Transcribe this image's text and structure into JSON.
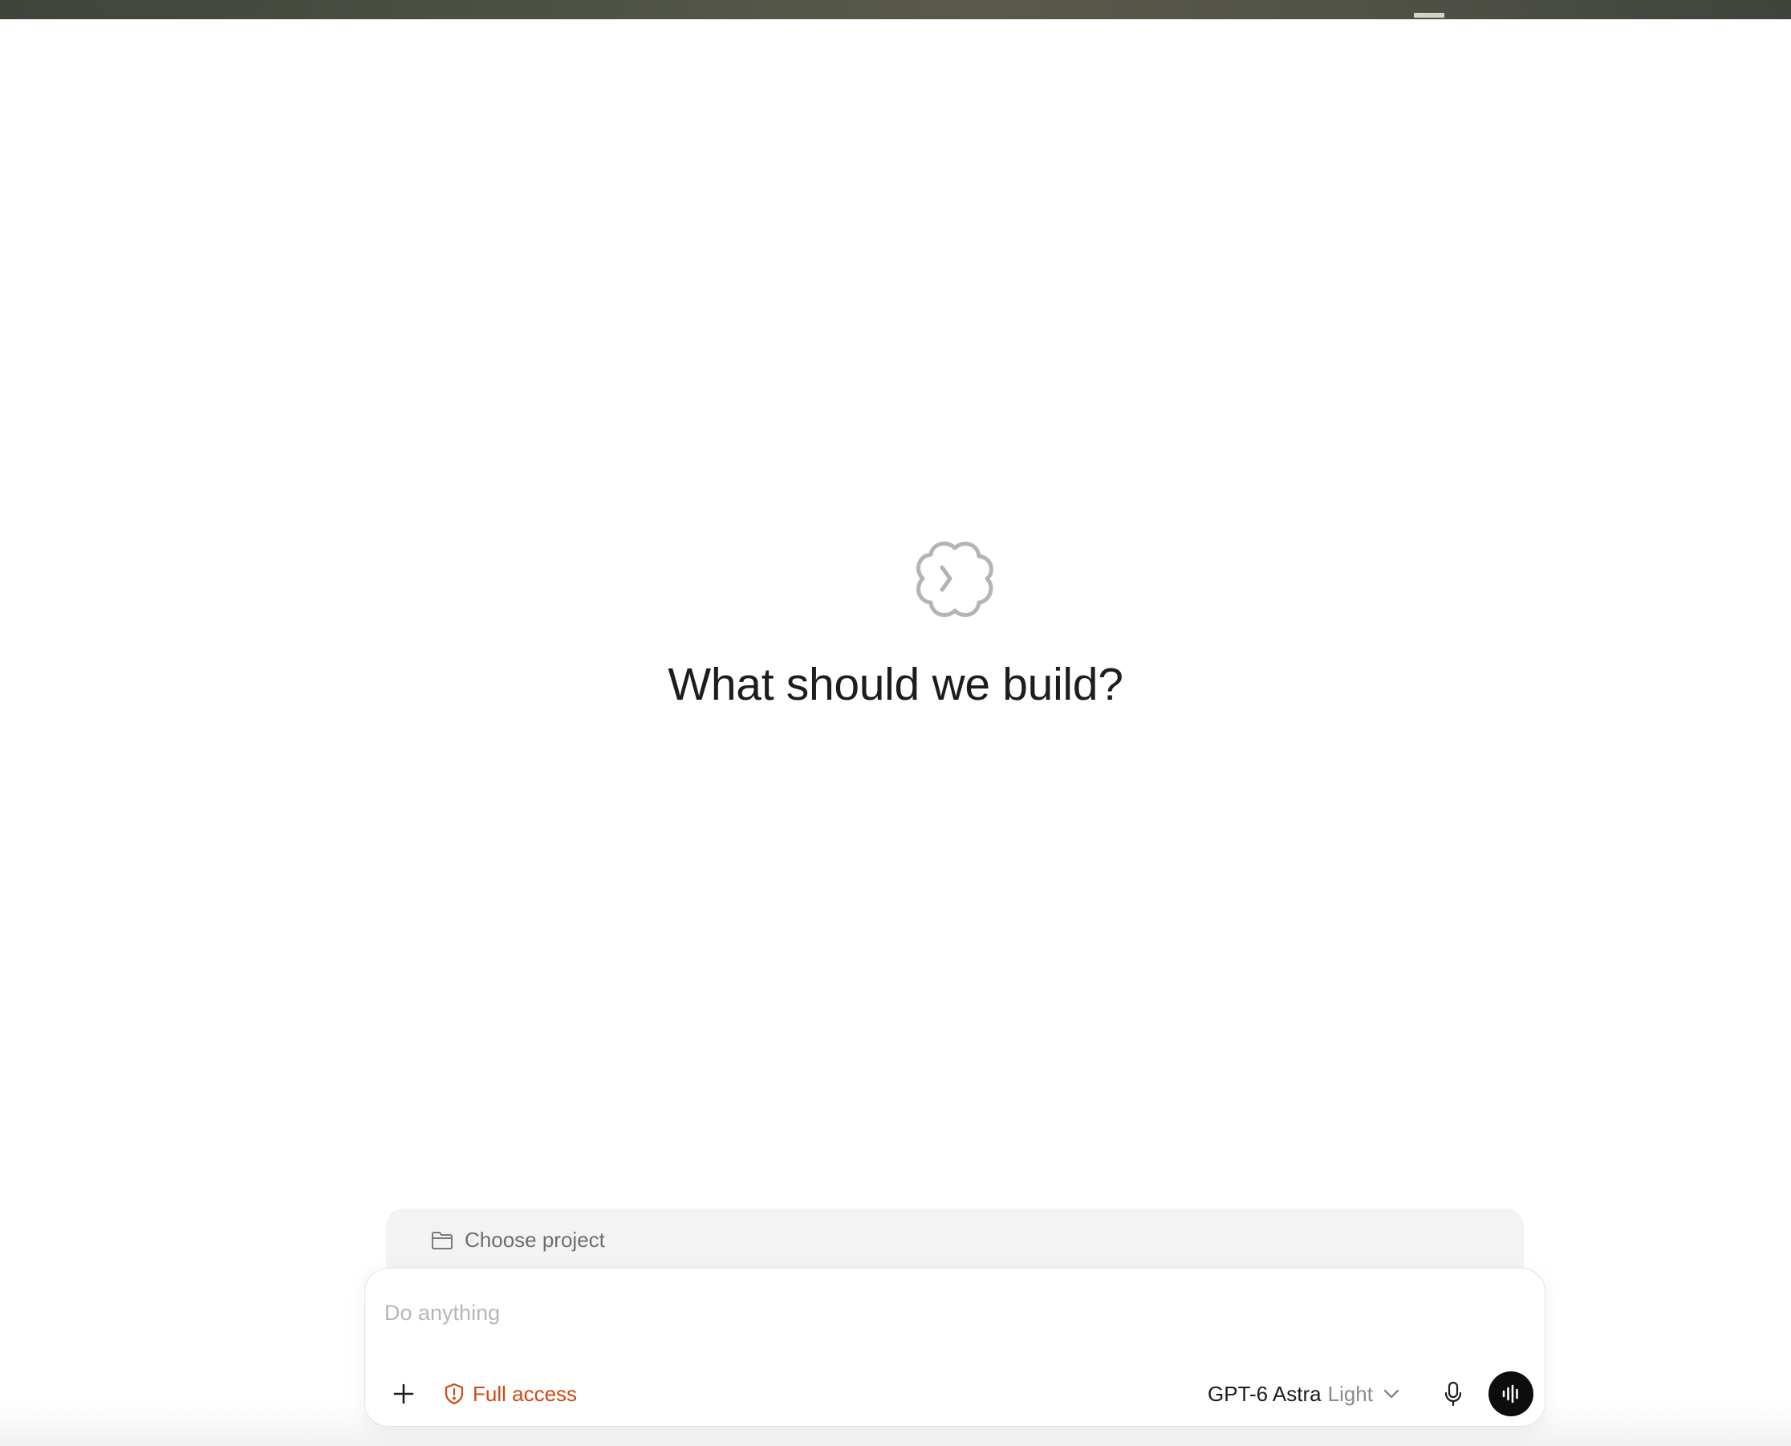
{
  "hero": {
    "title": "What should we build?",
    "logo_icon": "app-logo-icon"
  },
  "project": {
    "label": "Choose project",
    "icon": "folder-icon"
  },
  "composer": {
    "placeholder": "Do anything",
    "value": "",
    "add_icon": "plus-icon",
    "access_label": "Full access",
    "access_icon": "shield-alert-icon",
    "access_color": "#cc4a12",
    "model_name": "GPT-6 Astra",
    "model_mode": "Light",
    "model_icon": "chevron-down-icon",
    "mic_icon": "microphone-icon",
    "voice_icon": "voice-waveform-icon"
  }
}
